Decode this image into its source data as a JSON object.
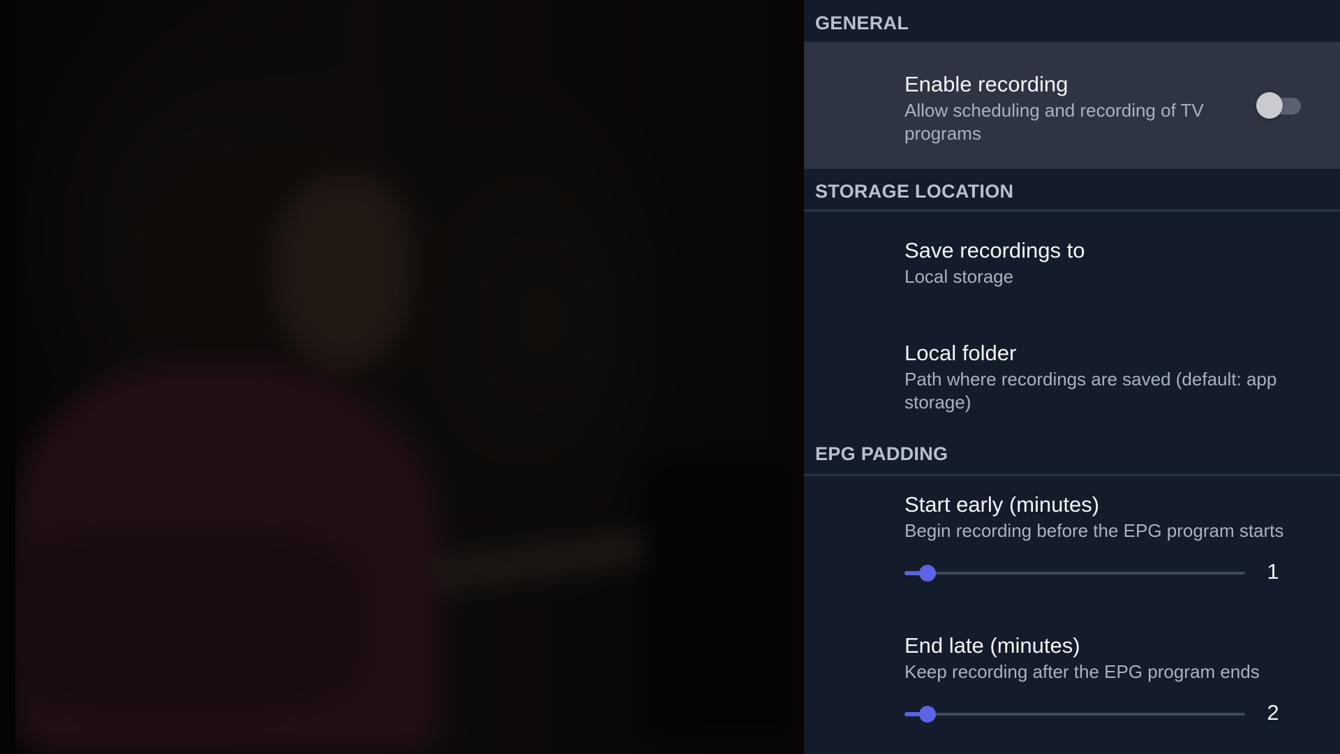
{
  "sections": {
    "general": {
      "header": "GENERAL",
      "enable_recording": {
        "title": "Enable recording",
        "subtitle": "Allow scheduling and recording of TV programs",
        "enabled": false
      }
    },
    "storage": {
      "header": "STORAGE LOCATION",
      "save_to": {
        "title": "Save recordings to",
        "subtitle": "Local storage"
      },
      "local_folder": {
        "title": "Local folder",
        "subtitle": "Path where recordings are saved (default: app storage)"
      }
    },
    "epg": {
      "header": "EPG PADDING",
      "start_early": {
        "title": "Start early (minutes)",
        "subtitle": "Begin recording before the EPG program starts",
        "value": "1",
        "level": 0.067
      },
      "end_late": {
        "title": "End late (minutes)",
        "subtitle": "Keep recording after the EPG program ends",
        "value": "2",
        "level": 0.067
      }
    }
  },
  "colors": {
    "panel_bg": "#141c2b",
    "highlight_row": "#2e3442",
    "accent": "#5b63e6"
  }
}
